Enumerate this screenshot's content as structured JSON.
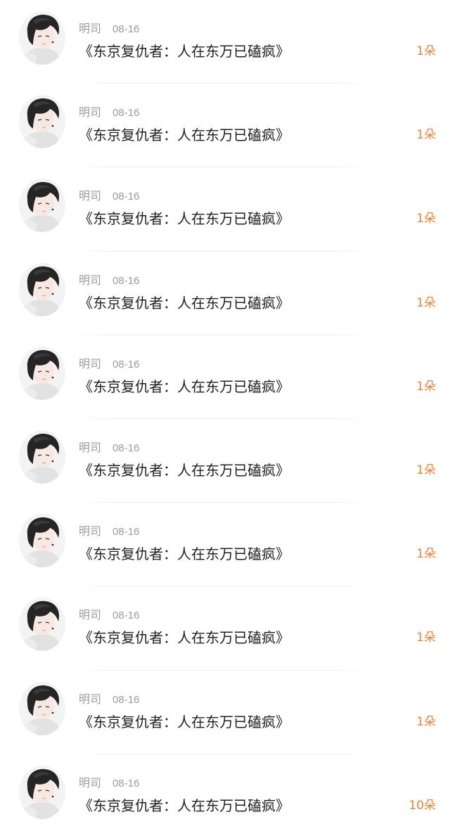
{
  "gift_records": [
    {
      "author": "明司",
      "date": "08-16",
      "title": "《东京复仇者：人在东万已磕疯》",
      "gift": "1朵"
    },
    {
      "author": "明司",
      "date": "08-16",
      "title": "《东京复仇者：人在东万已磕疯》",
      "gift": "1朵"
    },
    {
      "author": "明司",
      "date": "08-16",
      "title": "《东京复仇者：人在东万已磕疯》",
      "gift": "1朵"
    },
    {
      "author": "明司",
      "date": "08-16",
      "title": "《东京复仇者：人在东万已磕疯》",
      "gift": "1朵"
    },
    {
      "author": "明司",
      "date": "08-16",
      "title": "《东京复仇者：人在东万已磕疯》",
      "gift": "1朵"
    },
    {
      "author": "明司",
      "date": "08-16",
      "title": "《东京复仇者：人在东万已磕疯》",
      "gift": "1朵"
    },
    {
      "author": "明司",
      "date": "08-16",
      "title": "《东京复仇者：人在东万已磕疯》",
      "gift": "1朵"
    },
    {
      "author": "明司",
      "date": "08-16",
      "title": "《东京复仇者：人在东万已磕疯》",
      "gift": "1朵"
    },
    {
      "author": "明司",
      "date": "08-16",
      "title": "《东京复仇者：人在东万已磕疯》",
      "gift": "1朵"
    },
    {
      "author": "明司",
      "date": "08-16",
      "title": "《东京复仇者：人在东万已磕疯》",
      "gift": "10朵"
    }
  ],
  "theme": {
    "accent": "#e8843c",
    "meta_text": "#9b9b9b",
    "title_text": "#1f1f1f",
    "divider": "#eeeeee"
  },
  "icons": {
    "avatar": "anime-boy-portrait-avatar"
  }
}
